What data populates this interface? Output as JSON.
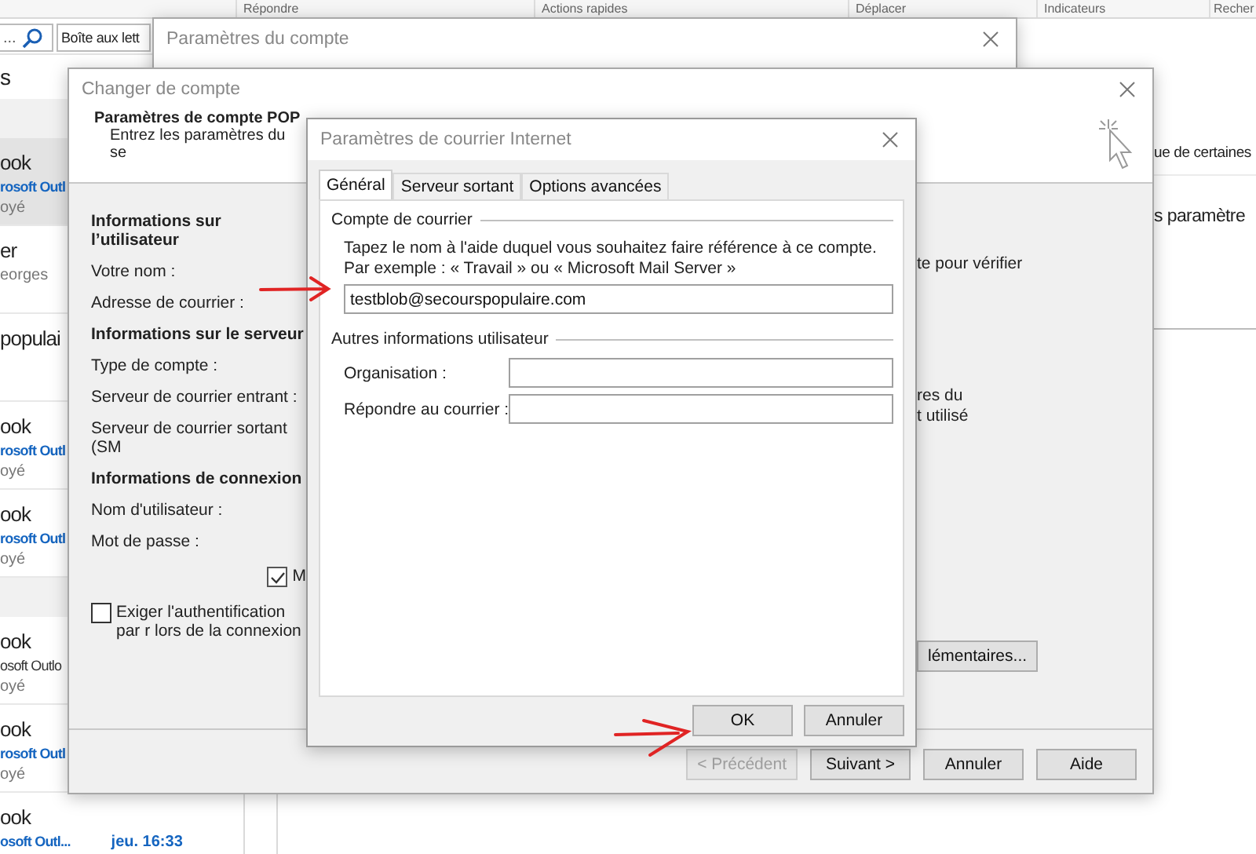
{
  "ribbon": {
    "groups": [
      "Répondre",
      "Actions rapides",
      "Déplacer",
      "Indicateurs",
      "Recher"
    ]
  },
  "search_bar": {
    "text": "...",
    "scope": "Boîte aux lett"
  },
  "message_list": [
    {
      "kind": "header",
      "text": "s"
    },
    {
      "kind": "divider"
    },
    {
      "kind": "message",
      "selected": true,
      "unread": true,
      "sender": "ook",
      "subject": "rosoft Outl",
      "preview": "oyé"
    },
    {
      "kind": "message",
      "selected": false,
      "sender": "er",
      "preview": "eorges"
    },
    {
      "kind": "message",
      "selected": false,
      "sender": "populai"
    },
    {
      "kind": "message",
      "selected": false,
      "unread": true,
      "sender": "ook",
      "subject": "rosoft Outl",
      "preview": "oyé"
    },
    {
      "kind": "message",
      "selected": false,
      "unread": true,
      "sender": "ook",
      "subject": "rosoft Outl",
      "preview": "oyé"
    },
    {
      "kind": "divider"
    },
    {
      "kind": "message",
      "selected": false,
      "unread": false,
      "sender": "ook",
      "subject": "osoft Outlo",
      "preview": "oyé"
    },
    {
      "kind": "message",
      "selected": false,
      "unread": true,
      "sender": "ook",
      "subject": "rosoft Outl",
      "preview": "oyé"
    },
    {
      "kind": "message",
      "selected": false,
      "unread": true,
      "sender": "ook",
      "subject": "osoft Outl...",
      "date": "jeu. 16:33"
    }
  ],
  "reading_pane": {
    "line_1": "ue de certaines",
    "line_2": "s paramètre"
  },
  "account_settings_window": {
    "title": "Paramètres du compte"
  },
  "change_account_window": {
    "title": "Changer de compte",
    "heading": "Paramètres de compte POP",
    "subheading": "Entrez les paramètres du se",
    "sections": [
      {
        "title": "Informations sur l’utilisateur",
        "fields": [
          "Votre nom :",
          "Adresse de courrier :"
        ]
      },
      {
        "title": "Informations sur le serveur",
        "fields": [
          "Type de compte :",
          "Serveur de courrier entrant :",
          "Serveur de courrier sortant (SM"
        ]
      },
      {
        "title": "Informations de connexion",
        "fields": [
          "Nom d'utilisateur :",
          "Mot de passe :"
        ]
      }
    ],
    "remember_checkbox": {
      "label": "M",
      "checked": true
    },
    "auth_checkbox": {
      "label": "Exiger l'authentification par r lors de la connexion",
      "checked": false
    },
    "right_texts": [
      "te pour vérifier",
      "res du",
      "t utilisé"
    ],
    "more_button": "lémentaires...",
    "buttons": [
      {
        "label": "< Précédent",
        "disabled": true
      },
      {
        "label": "Suivant >",
        "disabled": false
      },
      {
        "label": "Annuler",
        "disabled": false
      },
      {
        "label": "Aide",
        "disabled": false
      }
    ]
  },
  "internet_mail_dialog": {
    "title": "Paramètres de courrier Internet",
    "tabs": [
      {
        "label": "Général",
        "selected": true
      },
      {
        "label": "Serveur sortant",
        "selected": false
      },
      {
        "label": "Options avancées",
        "selected": false
      }
    ],
    "account_group": {
      "title": "Compte de courrier",
      "help": "Tapez le nom à l'aide duquel vous souhaitez faire référence à ce compte. Par exemple : « Travail » ou « Microsoft Mail Server »",
      "value": "testblob@secourspopulaire.com"
    },
    "other_group": {
      "title": "Autres informations utilisateur",
      "fields": [
        "Organisation :",
        "Répondre au courrier :"
      ]
    },
    "buttons": [
      "OK",
      "Annuler"
    ]
  }
}
